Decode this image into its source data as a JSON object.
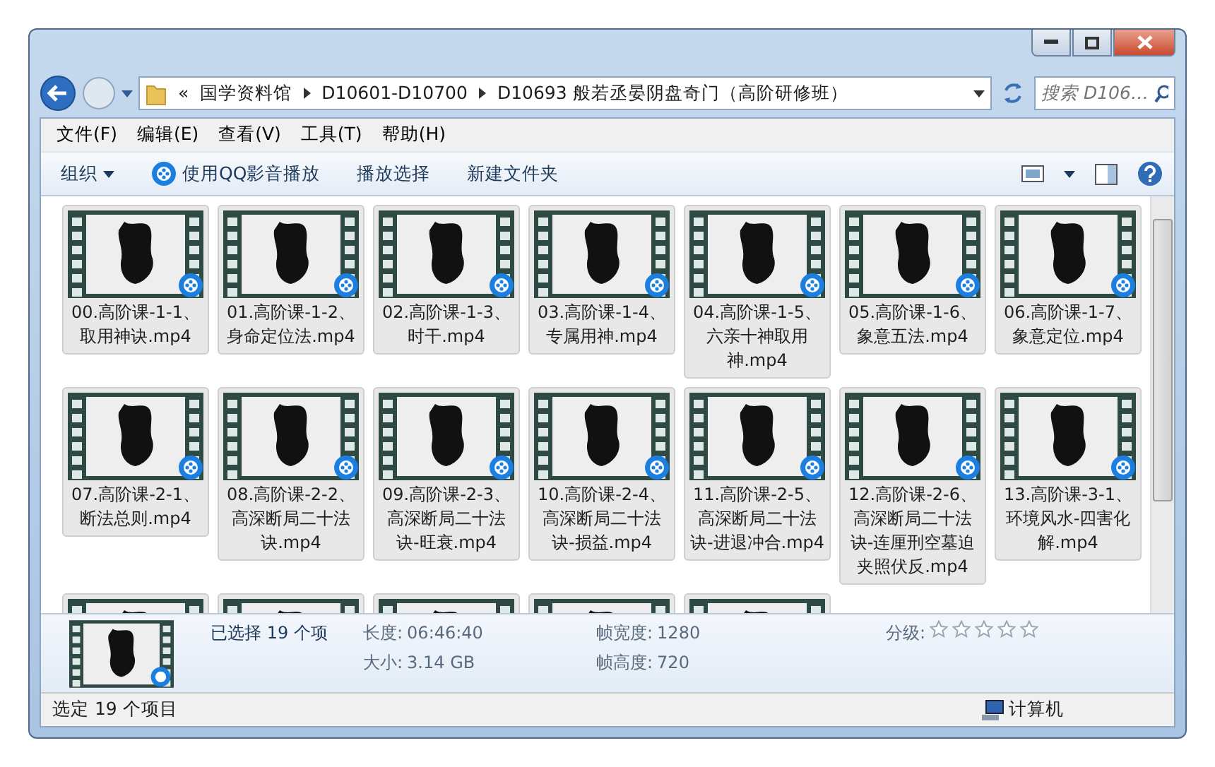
{
  "address_bar": {
    "overflow": "«",
    "breadcrumbs": [
      "国学资料馆",
      "D10601-D10700",
      "D10693 般若丞晏阴盘奇门（高阶研修班）"
    ]
  },
  "search": {
    "placeholder": "搜索 D106…"
  },
  "menu": [
    "文件(F)",
    "编辑(E)",
    "查看(V)",
    "工具(T)",
    "帮助(H)"
  ],
  "toolbar": [
    {
      "label": "组织",
      "kind": "dropdown"
    },
    {
      "label": "使用QQ影音播放",
      "kind": "icon"
    },
    {
      "label": "播放选择",
      "kind": "plain"
    },
    {
      "label": "新建文件夹",
      "kind": "plain"
    }
  ],
  "files": [
    {
      "name": "00.高阶课-1-1、取用神诀.mp4",
      "selected": true
    },
    {
      "name": "01.高阶课-1-2、身命定位法.mp4",
      "selected": true
    },
    {
      "name": "02.高阶课-1-3、时干.mp4",
      "selected": true
    },
    {
      "name": "03.高阶课-1-4、专属用神.mp4",
      "selected": true
    },
    {
      "name": "04.高阶课-1-5、六亲十神取用神.mp4",
      "selected": true
    },
    {
      "name": "05.高阶课-1-6、象意五法.mp4",
      "selected": true
    },
    {
      "name": "06.高阶课-1-7、象意定位.mp4",
      "selected": true
    },
    {
      "name": "07.高阶课-2-1、断法总则.mp4",
      "selected": true
    },
    {
      "name": "08.高阶课-2-2、高深断局二十法诀.mp4",
      "selected": true
    },
    {
      "name": "09.高阶课-2-3、高深断局二十法诀-旺衰.mp4",
      "selected": true
    },
    {
      "name": "10.高阶课-2-4、高深断局二十法诀-损益.mp4",
      "selected": true
    },
    {
      "name": "11.高阶课-2-5、高深断局二十法诀-进退冲合.mp4",
      "selected": true
    },
    {
      "name": "12.高阶课-2-6、高深断局二十法诀-连厘刑空墓迫夹照伏反.mp4",
      "selected": true
    },
    {
      "name": "13.高阶课-3-1、环境风水-四害化解.mp4",
      "selected": true
    },
    {
      "selected": true
    },
    {
      "selected": true
    },
    {
      "selected": true
    },
    {
      "selected": true
    },
    {
      "selected": true
    }
  ],
  "details": {
    "summary": "已选择 19 个项",
    "fields": [
      {
        "label": "长度:",
        "value": "06:46:40"
      },
      {
        "label": "大小:",
        "value": "3.14 GB"
      },
      {
        "label": "帧宽度:",
        "value": "1280"
      },
      {
        "label": "帧高度:",
        "value": "720"
      }
    ],
    "rating_label": "分级:",
    "stars": 0
  },
  "status_bar": {
    "text": "选定 19 个项目",
    "location": "计算机"
  }
}
